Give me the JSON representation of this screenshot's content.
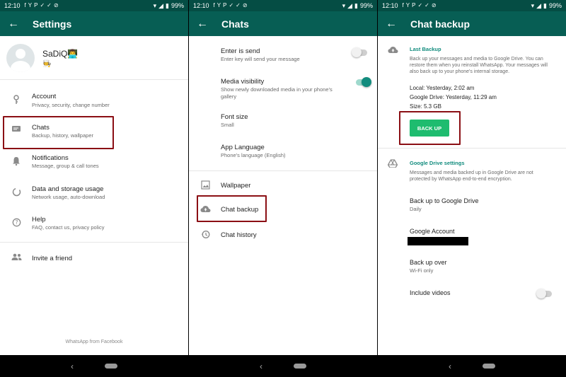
{
  "status_bar": {
    "time": "12:10",
    "battery": "99%",
    "left_icons": [
      "facebook-icon",
      "yahoo-icon",
      "pinterest-icon",
      "check-icon",
      "check-icon",
      "dnd-off-icon"
    ]
  },
  "panel1": {
    "title": "Settings",
    "profile": {
      "name": "SaDiQ👨‍💻",
      "status": "🧑‍🍳"
    },
    "items": [
      {
        "title": "Account",
        "subtitle": "Privacy, security, change number",
        "icon": "key-icon"
      },
      {
        "title": "Chats",
        "subtitle": "Backup, history, wallpaper",
        "icon": "chat-icon"
      },
      {
        "title": "Notifications",
        "subtitle": "Message, group & call tones",
        "icon": "bell-icon"
      },
      {
        "title": "Data and storage usage",
        "subtitle": "Network usage, auto-download",
        "icon": "data-icon"
      },
      {
        "title": "Help",
        "subtitle": "FAQ, contact us, privacy policy",
        "icon": "help-icon"
      }
    ],
    "invite": "Invite a friend",
    "footer": "WhatsApp from Facebook"
  },
  "panel2": {
    "title": "Chats",
    "items": [
      {
        "title": "Enter is send",
        "subtitle": "Enter key will send your message",
        "toggle": "off"
      },
      {
        "title": "Media visibility",
        "subtitle": "Show newly downloaded media in your phone's gallery",
        "toggle": "on"
      },
      {
        "title": "Font size",
        "subtitle": "Small"
      },
      {
        "title": "App Language",
        "subtitle": "Phone's language (English)"
      }
    ],
    "wallpaper": "Wallpaper",
    "chat_backup": "Chat backup",
    "chat_history": "Chat history"
  },
  "panel3": {
    "title": "Chat backup",
    "last_backup_title": "Last Backup",
    "last_backup_desc": "Back up your messages and media to Google Drive. You can restore them when you reinstall WhatsApp. Your messages will also back up to your phone's internal storage.",
    "local": "Local: Yesterday, 2:02 am",
    "google_drive": "Google Drive: Yesterday, 11:29 am",
    "size": "Size: 5.3 GB",
    "back_up_button": "BACK UP",
    "gdrive_title": "Google Drive settings",
    "gdrive_desc": "Messages and media backed up in Google Drive are not protected by WhatsApp end-to-end encryption.",
    "settings": [
      {
        "title": "Back up to Google Drive",
        "subtitle": "Daily"
      },
      {
        "title": "Google Account",
        "subtitle": ""
      },
      {
        "title": "Back up over",
        "subtitle": "Wi-Fi only"
      }
    ],
    "include_videos": "Include videos",
    "include_videos_toggle": "off"
  },
  "colors": {
    "status_bar": "#054d44",
    "app_bar": "#075e54",
    "accent": "#128c7e",
    "button": "#1ebc6f",
    "highlight_box": "#8b0f14"
  }
}
